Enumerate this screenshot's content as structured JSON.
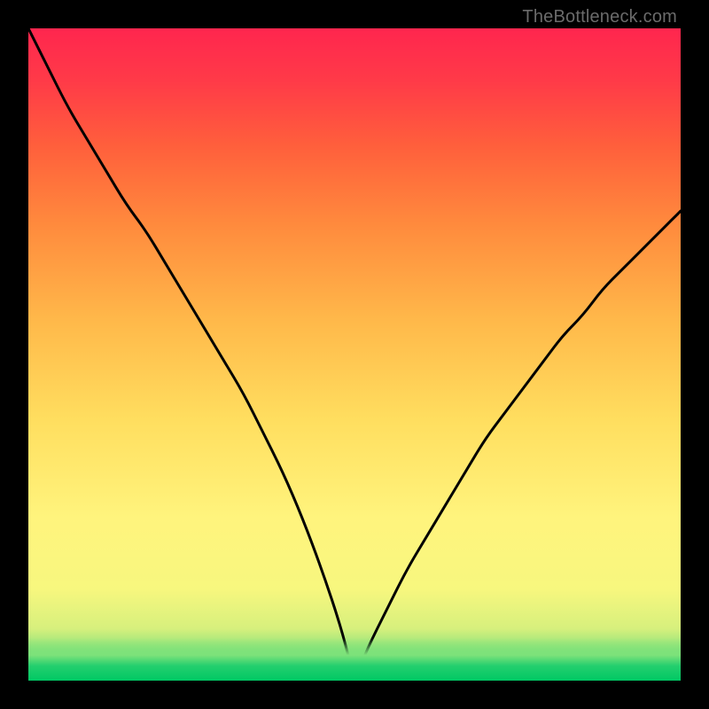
{
  "watermark": "TheBottleneck.com",
  "marker": {
    "left_frac": 0.466,
    "width_frac": 0.088
  },
  "chart_data": {
    "type": "line",
    "title": "",
    "xlabel": "",
    "ylabel": "",
    "xlim": [
      0,
      100
    ],
    "ylim": [
      0,
      100
    ],
    "x": [
      0,
      3,
      6,
      9,
      12,
      15,
      18,
      21,
      24,
      27,
      30,
      33,
      36,
      39,
      42,
      45,
      48,
      50,
      52,
      55,
      58,
      61,
      64,
      67,
      70,
      73,
      76,
      79,
      82,
      85,
      88,
      91,
      94,
      97,
      100
    ],
    "values": [
      100,
      94,
      88,
      83,
      78,
      73,
      69,
      64,
      59,
      54,
      49,
      44,
      38,
      32,
      25,
      17,
      8,
      0,
      5,
      11,
      17,
      22,
      27,
      32,
      37,
      41,
      45,
      49,
      53,
      56,
      60,
      63,
      66,
      69,
      72
    ],
    "annotations": []
  }
}
